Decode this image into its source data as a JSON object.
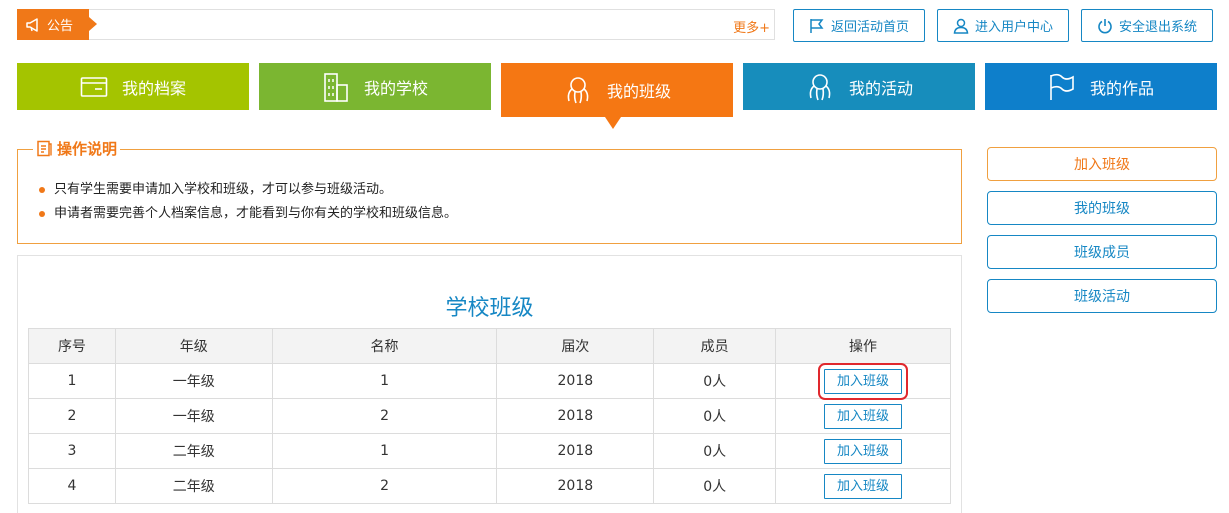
{
  "notice": {
    "label": "公告",
    "more": "更多+"
  },
  "top_actions": [
    {
      "label": "返回活动首页",
      "icon": "flag-icon"
    },
    {
      "label": "进入用户中心",
      "icon": "user-icon"
    },
    {
      "label": "安全退出系统",
      "icon": "power-icon"
    }
  ],
  "nav": [
    {
      "label": "我的档案",
      "color": "#a4c400"
    },
    {
      "label": "我的学校",
      "color": "#7bb631"
    },
    {
      "label": "我的班级",
      "color": "#f57713"
    },
    {
      "label": "我的活动",
      "color": "#178dbc"
    },
    {
      "label": "我的作品",
      "color": "#0e7fcb"
    }
  ],
  "instructions": {
    "title": "操作说明",
    "items": [
      "只有学生需要申请加入学校和班级，才可以参与班级活动。",
      "申请者需要完善个人档案信息，才能看到与你有关的学校和班级信息。"
    ]
  },
  "panel": {
    "title": "学校班级",
    "columns": [
      "序号",
      "年级",
      "名称",
      "届次",
      "成员",
      "操作"
    ],
    "rows": [
      {
        "no": "1",
        "grade": "一年级",
        "name": "1",
        "session": "2018",
        "members": "0人",
        "action": "加入班级"
      },
      {
        "no": "2",
        "grade": "一年级",
        "name": "2",
        "session": "2018",
        "members": "0人",
        "action": "加入班级"
      },
      {
        "no": "3",
        "grade": "二年级",
        "name": "1",
        "session": "2018",
        "members": "0人",
        "action": "加入班级"
      },
      {
        "no": "4",
        "grade": "二年级",
        "name": "2",
        "session": "2018",
        "members": "0人",
        "action": "加入班级"
      }
    ]
  },
  "side_menu": [
    {
      "label": "加入班级",
      "active": true
    },
    {
      "label": "我的班级",
      "active": false
    },
    {
      "label": "班级成员",
      "active": false
    },
    {
      "label": "班级活动",
      "active": false
    }
  ],
  "colors": {
    "accent_orange": "#f07818",
    "accent_blue": "#1687c4",
    "highlight_red": "#e0282d"
  }
}
